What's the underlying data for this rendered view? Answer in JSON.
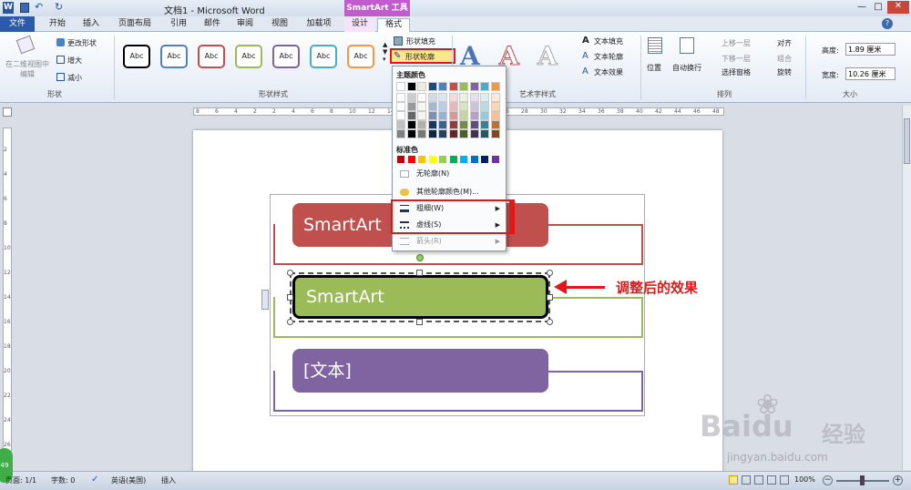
{
  "window": {
    "title": "文档1 - Microsoft Word",
    "context_tab": "SmartArt 工具"
  },
  "tabs": [
    "文件",
    "开始",
    "插入",
    "页面布局",
    "引用",
    "邮件",
    "审阅",
    "视图",
    "加载项",
    "设计",
    "格式"
  ],
  "ribbon": {
    "edit_in_2d": "在二维视图中编辑",
    "change_shape": "更改形状",
    "larger": "增大",
    "smaller": "减小",
    "shapes_group": "形状",
    "style_abc": "Abc",
    "shape_styles_group": "形状样式",
    "shape_fill": "形状填充",
    "shape_outline": "形状轮廓",
    "art_text_group": "艺术字样式",
    "text_fill": "文本填充",
    "text_outline": "文本轮廓",
    "text_effects": "文本效果",
    "position": "位置",
    "auto_wrap": "自动换行",
    "bring_forward": "上移一层",
    "send_backward": "下移一层",
    "selection_pane": "选择窗格",
    "align": "对齐",
    "group": "组合",
    "rotate": "旋转",
    "arrange_group": "排列",
    "height_label": "高度:",
    "height_value": "1.89 厘米",
    "width_label": "宽度:",
    "width_value": "10.26 厘米",
    "size_group": "大小"
  },
  "style_colors": [
    "#000000",
    "#4f81bd",
    "#c0504d",
    "#9bbb59",
    "#8064a2",
    "#4bacc6",
    "#f79646"
  ],
  "ruler": {
    "h_ticks": [
      "8",
      "6",
      "4",
      "2",
      "2",
      "4",
      "6",
      "8",
      "10",
      "12",
      "14",
      "16",
      "18",
      "20",
      "22",
      "24",
      "26",
      "28",
      "30",
      "32",
      "34",
      "36",
      "38",
      "40",
      "42",
      "44",
      "46",
      "48"
    ],
    "v_ticks": [
      "2",
      "4",
      "6",
      "8",
      "10",
      "12",
      "14",
      "16",
      "18",
      "20",
      "22",
      "24",
      "26"
    ]
  },
  "dropdown": {
    "theme_colors": "主题颜色",
    "standard_colors": "标准色",
    "no_outline": "无轮廓(N)",
    "more_colors": "其他轮廓颜色(M)...",
    "weight": "粗细(W)",
    "dashes": "虚线(S)",
    "arrows": "箭头(R)"
  },
  "theme_color_top": [
    "#ffffff",
    "#000000",
    "#eeece1",
    "#1f497d",
    "#4f81bd",
    "#c0504d",
    "#9bbb59",
    "#8064a2",
    "#4bacc6",
    "#f79646"
  ],
  "standard_color_list": [
    "#c00000",
    "#ff0000",
    "#ffc000",
    "#ffff00",
    "#92d050",
    "#00b050",
    "#00b0f0",
    "#0070c0",
    "#002060",
    "#7030a0"
  ],
  "smartart": {
    "box1": "SmartArt",
    "box2": "SmartArt",
    "box3": "[文本]",
    "color1": "#c0504d",
    "color2": "#9bbb59",
    "color3": "#8064a2"
  },
  "annotation": "调整后的效果",
  "status": {
    "page": "页面: 1/1",
    "words": "字数: 0",
    "lang": "英语(美国)",
    "insert": "插入",
    "zoom": "100%"
  },
  "watermark": {
    "brand": "Baidu",
    "cn": "经验",
    "url": "jingyan.baidu.com"
  }
}
